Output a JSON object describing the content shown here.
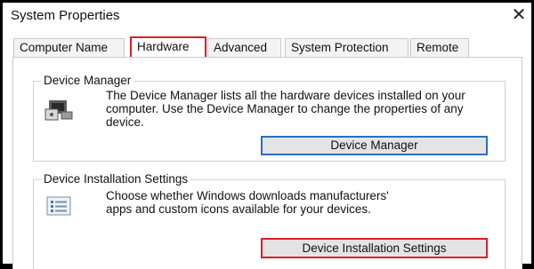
{
  "window": {
    "title": "System Properties",
    "close_glyph": "✕"
  },
  "tabs": [
    {
      "label": "Computer Name"
    },
    {
      "label": "Hardware",
      "active": true
    },
    {
      "label": "Advanced"
    },
    {
      "label": "System Protection"
    },
    {
      "label": "Remote"
    }
  ],
  "device_manager": {
    "group_label": "Device Manager",
    "description": "The Device Manager lists all the hardware devices installed on your computer. Use the Device Manager to change the properties of any device.",
    "button_label": "Device Manager",
    "icon": "device-manager-icon"
  },
  "device_installation": {
    "group_label": "Device Installation Settings",
    "description": "Choose whether Windows downloads manufacturers' apps and custom icons available for your devices.",
    "button_label": "Device Installation Settings",
    "icon": "checklist-icon"
  },
  "colors": {
    "highlight_red": "#d7202a",
    "focus_blue": "#2a6fc1"
  }
}
